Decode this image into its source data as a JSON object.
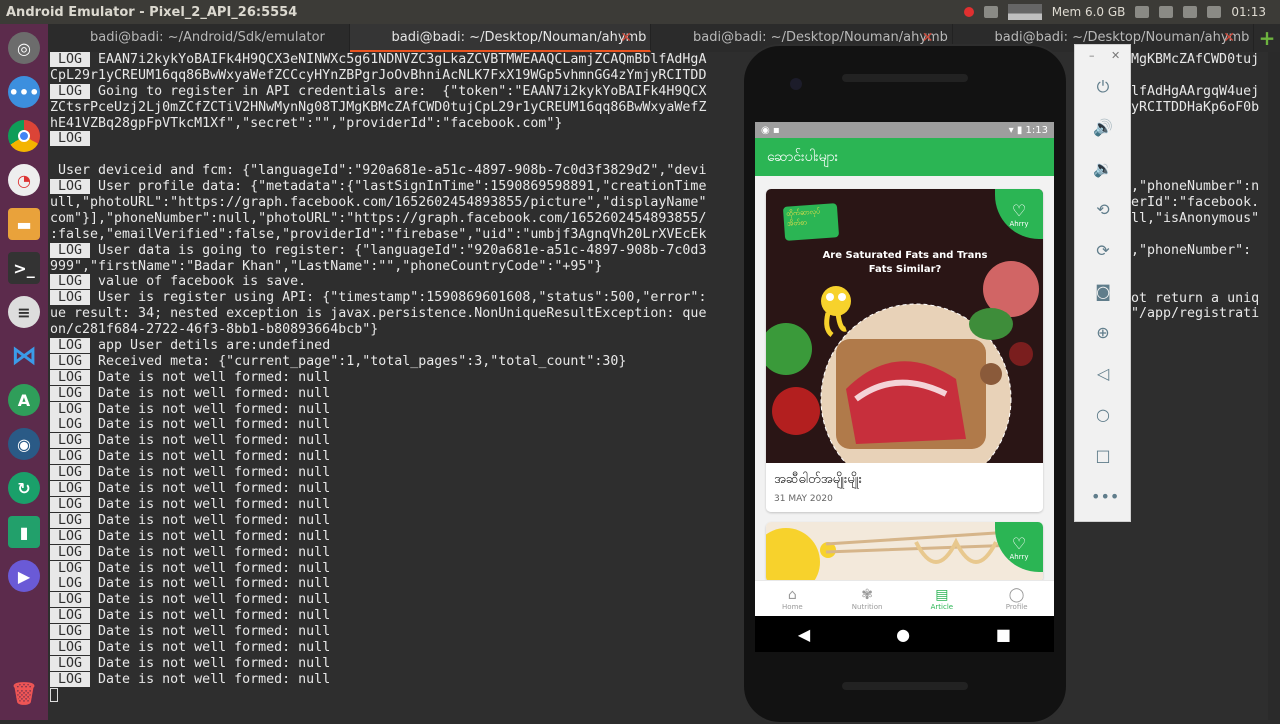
{
  "topbar": {
    "title": "Android Emulator - Pixel_2_API_26:5554",
    "mem": "Mem 6.0 GB",
    "clock": "01:13"
  },
  "tabs": [
    {
      "label": "badi@badi: ~/Android/Sdk/emulator"
    },
    {
      "label": "badi@badi: ~/Desktop/Nouman/ahymb"
    },
    {
      "label": "badi@badi: ~/Desktop/Nouman/ahymb"
    },
    {
      "label": "badi@badi: ~/Desktop/Nouman/ahymb"
    }
  ],
  "terminal": {
    "lines": [
      {
        "tag": "LOG",
        "text": " EAAN7i2kykYoBAIFk4H9QCX3eNINWXc5g61NDNVZC3gLkaZCVBTMWEAAQCLamjZCAQmBblfAdHgA"
      },
      {
        "tag": "",
        "text": "CpL29r1yCREUM16qq86BwWxyaWefZCCcyHYnZBPgrJoOvBhniAcNLK7FxX19WGp5vhmnGG4zYmjyRCITDD"
      },
      {
        "tag": "LOG",
        "text": " Going to register in API credentials are:  {\"token\":\"EAAN7i2kykYoBAIFk4H9QCX"
      },
      {
        "tag": "",
        "text": "ZCtsrPceUzj2Lj0mZCfZCTiV2HNwMynNg08TJMgKBMcZAfCWD0tujCpL29r1yCREUM16qq86BwWxyaWefZ"
      },
      {
        "tag": "",
        "text": "hE41VZBq28gpFpVTkcM1Xf\",\"secret\":\"\",\"providerId\":\"facebook.com\"}"
      },
      {
        "tag": "LOG",
        "text": ""
      },
      {
        "tag": "",
        "text": ""
      },
      {
        "tag": "",
        "text": " User deviceid and fcm: {\"languageId\":\"920a681e-a51c-4897-908b-7c0d3f3829d2\",\"devi"
      },
      {
        "tag": "LOG",
        "text": " User profile data: {\"metadata\":{\"lastSignInTime\":1590869598891,\"creationTime"
      },
      {
        "tag": "",
        "text": "ull,\"photoURL\":\"https://graph.facebook.com/1652602454893855/picture\",\"displayName\""
      },
      {
        "tag": "",
        "text": "com\"}],\"phoneNumber\":null,\"photoURL\":\"https://graph.facebook.com/1652602454893855/"
      },
      {
        "tag": "",
        "text": ":false,\"emailVerified\":false,\"providerId\":\"firebase\",\"uid\":\"umbjf3AgnqVh20LrXVEcEk"
      },
      {
        "tag": "LOG",
        "text": " User data is going to register: {\"languageId\":\"920a681e-a51c-4897-908b-7c0d3"
      },
      {
        "tag": "",
        "text": "999\",\"firstName\":\"Badar Khan\",\"LastName\":\"\",\"phoneCountryCode\":\"+95\"}"
      },
      {
        "tag": "LOG",
        "text": " value of facebook is save."
      },
      {
        "tag": "LOG",
        "text": " User is register using API: {\"timestamp\":1590869601608,\"status\":500,\"error\":"
      },
      {
        "tag": "",
        "text": "ue result: 34; nested exception is javax.persistence.NonUniqueResultException: que"
      },
      {
        "tag": "",
        "text": "on/c281f684-2722-46f3-8bb1-b80893664bcb\"}"
      },
      {
        "tag": "LOG",
        "text": " app User detils are:undefined"
      },
      {
        "tag": "LOG",
        "text": " Received meta: {\"current_page\":1,\"total_pages\":3,\"total_count\":30}"
      },
      {
        "tag": "LOG",
        "text": " Date is not well formed: null"
      },
      {
        "tag": "LOG",
        "text": " Date is not well formed: null"
      },
      {
        "tag": "LOG",
        "text": " Date is not well formed: null"
      },
      {
        "tag": "LOG",
        "text": " Date is not well formed: null"
      },
      {
        "tag": "LOG",
        "text": " Date is not well formed: null"
      },
      {
        "tag": "LOG",
        "text": " Date is not well formed: null"
      },
      {
        "tag": "LOG",
        "text": " Date is not well formed: null"
      },
      {
        "tag": "LOG",
        "text": " Date is not well formed: null"
      },
      {
        "tag": "LOG",
        "text": " Date is not well formed: null"
      },
      {
        "tag": "LOG",
        "text": " Date is not well formed: null"
      },
      {
        "tag": "LOG",
        "text": " Date is not well formed: null"
      },
      {
        "tag": "LOG",
        "text": " Date is not well formed: null"
      },
      {
        "tag": "LOG",
        "text": " Date is not well formed: null"
      },
      {
        "tag": "LOG",
        "text": " Date is not well formed: null"
      },
      {
        "tag": "LOG",
        "text": " Date is not well formed: null"
      },
      {
        "tag": "LOG",
        "text": " Date is not well formed: null"
      },
      {
        "tag": "LOG",
        "text": " Date is not well formed: null"
      },
      {
        "tag": "LOG",
        "text": " Date is not well formed: null"
      },
      {
        "tag": "LOG",
        "text": " Date is not well formed: null"
      },
      {
        "tag": "LOG",
        "text": " Date is not well formed: null"
      }
    ],
    "right_lines": [
      {
        "row": 0,
        "text": "MgKBMcZAfCWD0tuj"
      },
      {
        "row": 2,
        "text": "lfAdHgAArgqW4uej"
      },
      {
        "row": 3,
        "text": "yRCITDDHaKp6oF0b"
      },
      {
        "row": 8,
        "text": ",\"phoneNumber\":n"
      },
      {
        "row": 9,
        "text": "erId\":\"facebook."
      },
      {
        "row": 10,
        "text": "ll,\"isAnonymous\""
      },
      {
        "row": 12,
        "text": ",\"phoneNumber\":"
      },
      {
        "row": 15,
        "text": "ot return a uniq"
      },
      {
        "row": 16,
        "text": "\"/app/registrati"
      }
    ]
  },
  "phone": {
    "status_time": "1:13",
    "appbar_title": "ဆောင်းပါးများ",
    "card1": {
      "brand": "ထိုက်ဆာလုပ် အိတ်စာ",
      "headline": "Are Saturated Fats and Trans Fats Similar?",
      "badge": "Ahrry",
      "title": "အဆီဓါတ်အမျိုးမျိုး",
      "date": "31 MAY 2020"
    },
    "card2": {
      "badge": "Ahrry"
    },
    "nav": [
      {
        "label": "Home",
        "icon": "home-icon"
      },
      {
        "label": "Nutrition",
        "icon": "nutrition-icon"
      },
      {
        "label": "Article",
        "icon": "article-icon"
      },
      {
        "label": "Profile",
        "icon": "profile-icon"
      }
    ]
  },
  "colors": {
    "accent": "#2bb554",
    "dock": "#5c2b4c",
    "terminal_bg": "#2e2e2e"
  }
}
